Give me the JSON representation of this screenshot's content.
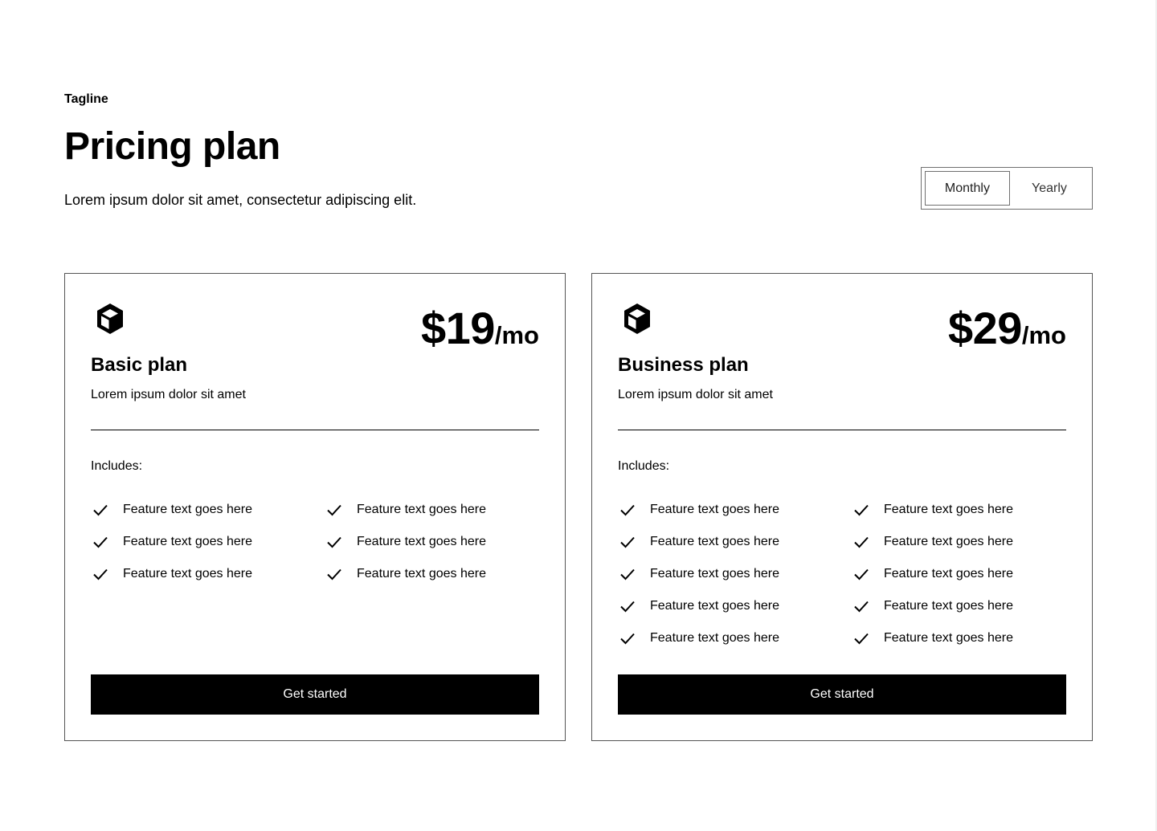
{
  "header": {
    "tagline": "Tagline",
    "title": "Pricing plan",
    "description": "Lorem ipsum dolor sit amet, consectetur adipiscing elit."
  },
  "billing_toggle": {
    "options": [
      "Monthly",
      "Yearly"
    ],
    "selected": "Monthly"
  },
  "plans": [
    {
      "icon": "cube-icon",
      "price": "$19",
      "period": "/mo",
      "name": "Basic plan",
      "description": "Lorem ipsum dolor sit amet",
      "includes_label": "Includes:",
      "features": [
        "Feature text goes here",
        "Feature text goes here",
        "Feature text goes here",
        "Feature text goes here",
        "Feature text goes here",
        "Feature text goes here"
      ],
      "cta_label": "Get started"
    },
    {
      "icon": "cube-icon",
      "price": "$29",
      "period": "/mo",
      "name": "Business plan",
      "description": "Lorem ipsum dolor sit amet",
      "includes_label": "Includes:",
      "features": [
        "Feature text goes here",
        "Feature text goes here",
        "Feature text goes here",
        "Feature text goes here",
        "Feature text goes here",
        "Feature text goes here",
        "Feature text goes here",
        "Feature text goes here",
        "Feature text goes here",
        "Feature text goes here"
      ],
      "cta_label": "Get started"
    }
  ],
  "colors": {
    "background": "#ffffff",
    "text": "#000000",
    "button": "#000000",
    "button_text": "#ffffff",
    "border": "#555555"
  }
}
